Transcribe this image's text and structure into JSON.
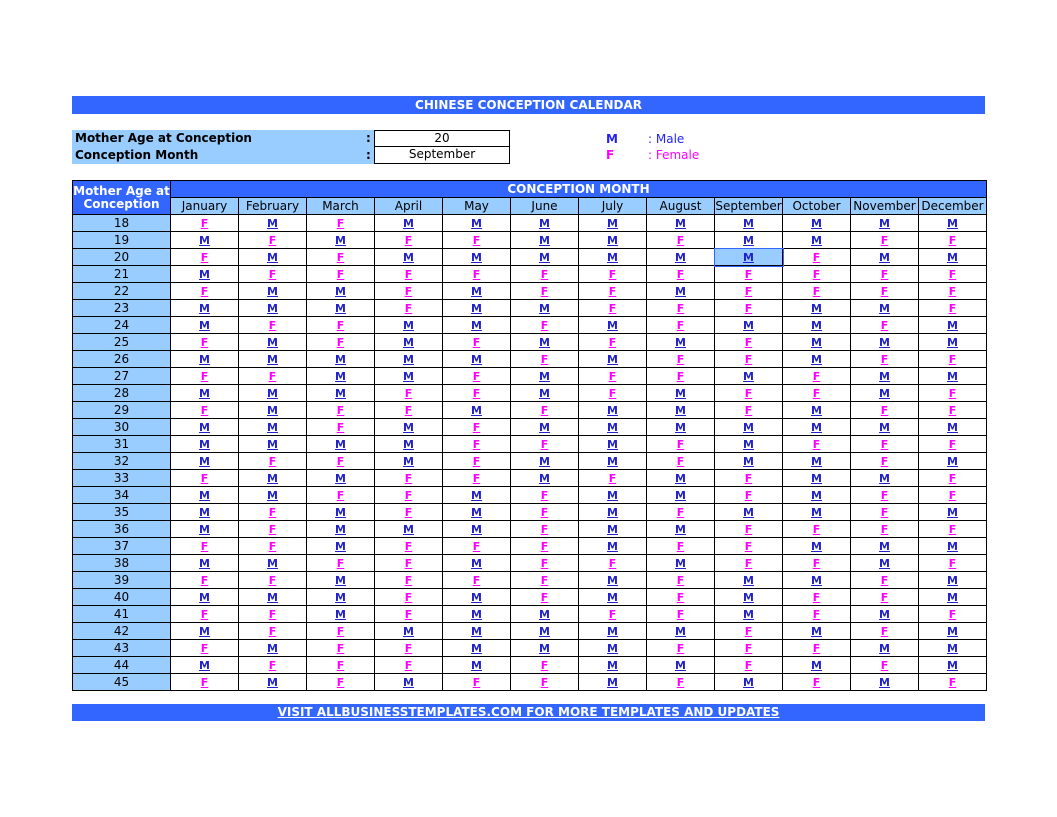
{
  "title": "CHINESE CONCEPTION CALENDAR",
  "inputs": {
    "age_label": "Mother Age at Conception",
    "age_value": "20",
    "month_label": "Conception Month",
    "month_value": "September",
    "colon": ":"
  },
  "legend": {
    "male_key": "M",
    "male_label": ": Male",
    "female_key": "F",
    "female_label": ": Female"
  },
  "colors": {
    "header": "#3366ff",
    "label_bg": "#99ccff",
    "male": "#2222cc",
    "female": "#ff00ff"
  },
  "table": {
    "age_header": "Mother Age at Conception",
    "month_header": "CONCEPTION MONTH",
    "months": [
      "January",
      "February",
      "March",
      "April",
      "May",
      "June",
      "July",
      "August",
      "September",
      "October",
      "November",
      "December"
    ],
    "selected": {
      "age": "20",
      "month": "September"
    },
    "rows": [
      {
        "age": "18",
        "values": [
          "F",
          "M",
          "F",
          "M",
          "M",
          "M",
          "M",
          "M",
          "M",
          "M",
          "M",
          "M"
        ]
      },
      {
        "age": "19",
        "values": [
          "M",
          "F",
          "M",
          "F",
          "F",
          "M",
          "M",
          "F",
          "M",
          "M",
          "F",
          "F"
        ]
      },
      {
        "age": "20",
        "values": [
          "F",
          "M",
          "F",
          "M",
          "M",
          "M",
          "M",
          "M",
          "M",
          "F",
          "M",
          "M"
        ]
      },
      {
        "age": "21",
        "values": [
          "M",
          "F",
          "F",
          "F",
          "F",
          "F",
          "F",
          "F",
          "F",
          "F",
          "F",
          "F"
        ]
      },
      {
        "age": "22",
        "values": [
          "F",
          "M",
          "M",
          "F",
          "M",
          "F",
          "F",
          "M",
          "F",
          "F",
          "F",
          "F"
        ]
      },
      {
        "age": "23",
        "values": [
          "M",
          "M",
          "M",
          "F",
          "M",
          "M",
          "F",
          "F",
          "F",
          "M",
          "M",
          "F"
        ]
      },
      {
        "age": "24",
        "values": [
          "M",
          "F",
          "F",
          "M",
          "M",
          "F",
          "M",
          "F",
          "M",
          "M",
          "F",
          "M"
        ]
      },
      {
        "age": "25",
        "values": [
          "F",
          "M",
          "F",
          "M",
          "F",
          "M",
          "F",
          "M",
          "F",
          "M",
          "M",
          "M"
        ]
      },
      {
        "age": "26",
        "values": [
          "M",
          "M",
          "M",
          "M",
          "M",
          "F",
          "M",
          "F",
          "F",
          "M",
          "F",
          "F"
        ]
      },
      {
        "age": "27",
        "values": [
          "F",
          "F",
          "M",
          "M",
          "F",
          "M",
          "F",
          "F",
          "M",
          "F",
          "M",
          "M"
        ]
      },
      {
        "age": "28",
        "values": [
          "M",
          "M",
          "M",
          "F",
          "F",
          "M",
          "F",
          "M",
          "F",
          "F",
          "M",
          "F"
        ]
      },
      {
        "age": "29",
        "values": [
          "F",
          "M",
          "F",
          "F",
          "M",
          "F",
          "M",
          "M",
          "F",
          "M",
          "F",
          "F"
        ]
      },
      {
        "age": "30",
        "values": [
          "M",
          "M",
          "F",
          "M",
          "F",
          "M",
          "M",
          "M",
          "M",
          "M",
          "M",
          "M"
        ]
      },
      {
        "age": "31",
        "values": [
          "M",
          "M",
          "M",
          "M",
          "F",
          "F",
          "M",
          "F",
          "M",
          "F",
          "F",
          "F"
        ]
      },
      {
        "age": "32",
        "values": [
          "M",
          "F",
          "F",
          "M",
          "F",
          "M",
          "M",
          "F",
          "M",
          "M",
          "F",
          "M"
        ]
      },
      {
        "age": "33",
        "values": [
          "F",
          "M",
          "M",
          "F",
          "F",
          "M",
          "F",
          "M",
          "F",
          "M",
          "M",
          "F"
        ]
      },
      {
        "age": "34",
        "values": [
          "M",
          "M",
          "F",
          "F",
          "M",
          "F",
          "M",
          "M",
          "F",
          "M",
          "F",
          "F"
        ]
      },
      {
        "age": "35",
        "values": [
          "M",
          "F",
          "M",
          "F",
          "M",
          "F",
          "M",
          "F",
          "M",
          "M",
          "F",
          "M"
        ]
      },
      {
        "age": "36",
        "values": [
          "M",
          "F",
          "M",
          "M",
          "M",
          "F",
          "M",
          "M",
          "F",
          "F",
          "F",
          "F"
        ]
      },
      {
        "age": "37",
        "values": [
          "F",
          "F",
          "M",
          "F",
          "F",
          "F",
          "M",
          "F",
          "F",
          "M",
          "M",
          "M"
        ]
      },
      {
        "age": "38",
        "values": [
          "M",
          "M",
          "F",
          "F",
          "M",
          "F",
          "F",
          "M",
          "F",
          "F",
          "M",
          "F"
        ]
      },
      {
        "age": "39",
        "values": [
          "F",
          "F",
          "M",
          "F",
          "F",
          "F",
          "M",
          "F",
          "M",
          "M",
          "F",
          "M"
        ]
      },
      {
        "age": "40",
        "values": [
          "M",
          "M",
          "M",
          "F",
          "M",
          "F",
          "M",
          "F",
          "M",
          "F",
          "F",
          "M"
        ]
      },
      {
        "age": "41",
        "values": [
          "F",
          "F",
          "M",
          "F",
          "M",
          "M",
          "F",
          "F",
          "M",
          "F",
          "M",
          "F"
        ]
      },
      {
        "age": "42",
        "values": [
          "M",
          "F",
          "F",
          "M",
          "M",
          "M",
          "M",
          "M",
          "F",
          "M",
          "F",
          "M"
        ]
      },
      {
        "age": "43",
        "values": [
          "F",
          "M",
          "F",
          "F",
          "M",
          "M",
          "M",
          "F",
          "F",
          "F",
          "M",
          "M"
        ]
      },
      {
        "age": "44",
        "values": [
          "M",
          "F",
          "F",
          "F",
          "M",
          "F",
          "M",
          "M",
          "F",
          "M",
          "F",
          "M"
        ]
      },
      {
        "age": "45",
        "values": [
          "F",
          "M",
          "F",
          "M",
          "F",
          "F",
          "M",
          "F",
          "M",
          "F",
          "M",
          "F"
        ]
      }
    ]
  },
  "footer": {
    "link": "VISIT ALLBUSINESSTEMPLATES.COM FOR MORE TEMPLATES AND UPDATES"
  }
}
